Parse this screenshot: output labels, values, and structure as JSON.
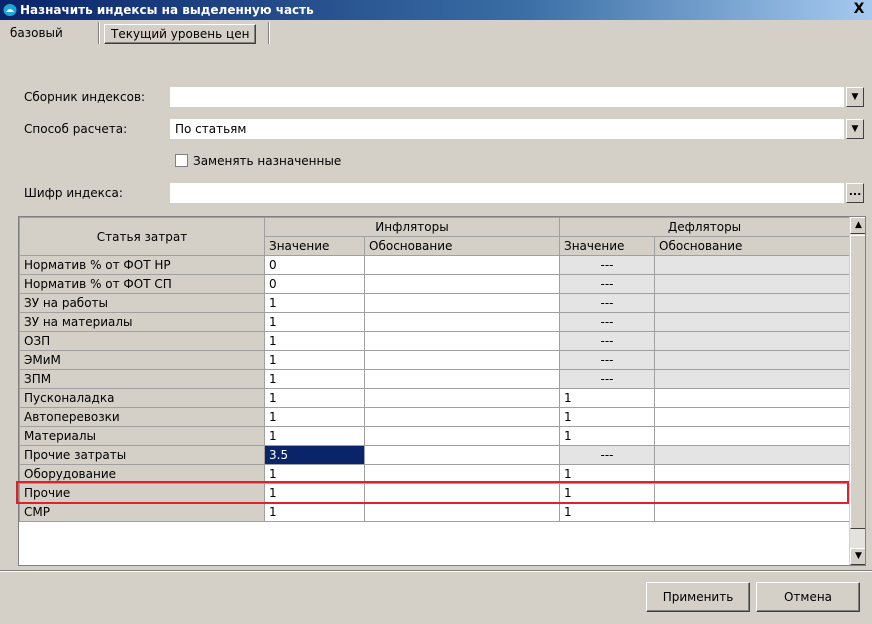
{
  "window": {
    "title": "Назначить индексы на выделенную часть",
    "close_glyph": "X"
  },
  "tabs": [
    {
      "label": "базовый"
    },
    {
      "label": "Текущий уровень цен"
    }
  ],
  "form": {
    "collection_label": "Сборник индексов:",
    "collection_value": "",
    "method_label": "Способ расчета:",
    "method_value": "По статьям",
    "replace_label": "Заменять назначенные",
    "replace_checked": false,
    "code_label": "Шифр индекса:",
    "code_value": "",
    "ellipsis_glyph": "..."
  },
  "grid": {
    "col_article": "Статья затрат",
    "group_inflators": "Инфляторы",
    "group_deflators": "Дефляторы",
    "col_value": "Значение",
    "col_reason": "Обоснование",
    "rows": [
      {
        "name": "Норматив % от ФОТ НР",
        "infl_value": "0",
        "infl_reason": "",
        "defl_value": "---",
        "defl_reason": ""
      },
      {
        "name": "Норматив % от ФОТ СП",
        "infl_value": "0",
        "infl_reason": "",
        "defl_value": "---",
        "defl_reason": ""
      },
      {
        "name": "ЗУ на работы",
        "infl_value": "1",
        "infl_reason": "",
        "defl_value": "---",
        "defl_reason": ""
      },
      {
        "name": "ЗУ на материалы",
        "infl_value": "1",
        "infl_reason": "",
        "defl_value": "---",
        "defl_reason": ""
      },
      {
        "name": "ОЗП",
        "infl_value": "1",
        "infl_reason": "",
        "defl_value": "---",
        "defl_reason": ""
      },
      {
        "name": "ЭМиМ",
        "infl_value": "1",
        "infl_reason": "",
        "defl_value": "---",
        "defl_reason": ""
      },
      {
        "name": "ЗПМ",
        "infl_value": "1",
        "infl_reason": "",
        "defl_value": "---",
        "defl_reason": ""
      },
      {
        "name": "Пусконаладка",
        "infl_value": "1",
        "infl_reason": "",
        "defl_value": "1",
        "defl_reason": ""
      },
      {
        "name": "Автоперевозки",
        "infl_value": "1",
        "infl_reason": "",
        "defl_value": "1",
        "defl_reason": ""
      },
      {
        "name": "Материалы",
        "infl_value": "1",
        "infl_reason": "",
        "defl_value": "1",
        "defl_reason": ""
      },
      {
        "name": "Прочие затраты",
        "infl_value": "3.5",
        "infl_reason": "",
        "defl_value": "---",
        "defl_reason": ""
      },
      {
        "name": "Оборудование",
        "infl_value": "1",
        "infl_reason": "",
        "defl_value": "1",
        "defl_reason": ""
      },
      {
        "name": "Прочие",
        "infl_value": "1",
        "infl_reason": "",
        "defl_value": "1",
        "defl_reason": ""
      },
      {
        "name": "СМР",
        "infl_value": "1",
        "infl_reason": "",
        "defl_value": "1",
        "defl_reason": ""
      }
    ]
  },
  "buttons": {
    "apply": "Применить",
    "cancel": "Отмена"
  },
  "colors": {
    "selection": "#0a246a",
    "highlight_border": "#e0202a",
    "titlebar": "#0a246a"
  },
  "icons": {
    "app": "app-icon",
    "close": "close-icon",
    "dropdown": "chevron-down-icon",
    "ellipsis": "ellipsis-icon",
    "scroll_up": "scroll-up-icon",
    "scroll_down": "scroll-down-icon"
  }
}
